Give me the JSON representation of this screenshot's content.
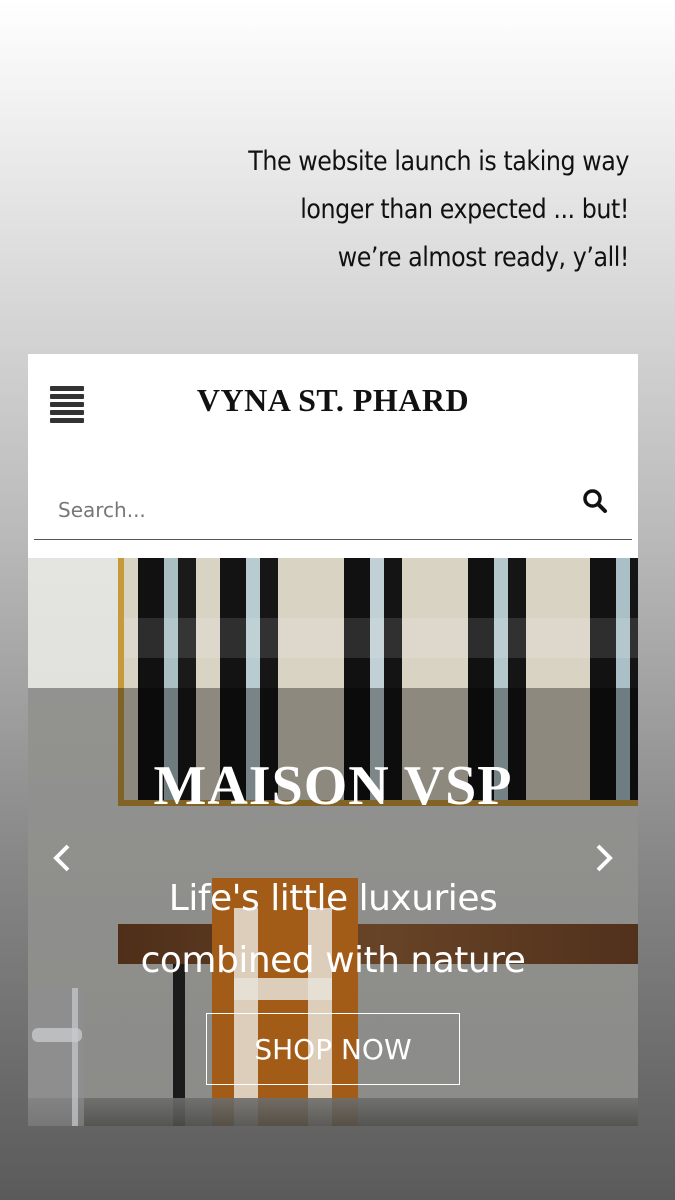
{
  "caption": {
    "line1": "The website launch is taking way",
    "line2": "longer than expected ... but!",
    "line3": "we’re almost ready, y’all!"
  },
  "header": {
    "brand": "VYNA ST. PHARD",
    "menu_icon": "hamburger-menu-icon"
  },
  "search": {
    "placeholder": "Search...",
    "value": "",
    "icon": "search-icon"
  },
  "hero": {
    "title": "MAISON VSP",
    "subtitle_line1": "Life's little luxuries",
    "subtitle_line2": "combined with nature",
    "cta_label": "SHOP NOW",
    "prev_icon": "chevron-left-icon",
    "next_icon": "chevron-right-icon"
  },
  "colors": {
    "brand_text": "#111111",
    "cta_border": "#ffffff",
    "blanket_orange": "#d17a1f"
  }
}
